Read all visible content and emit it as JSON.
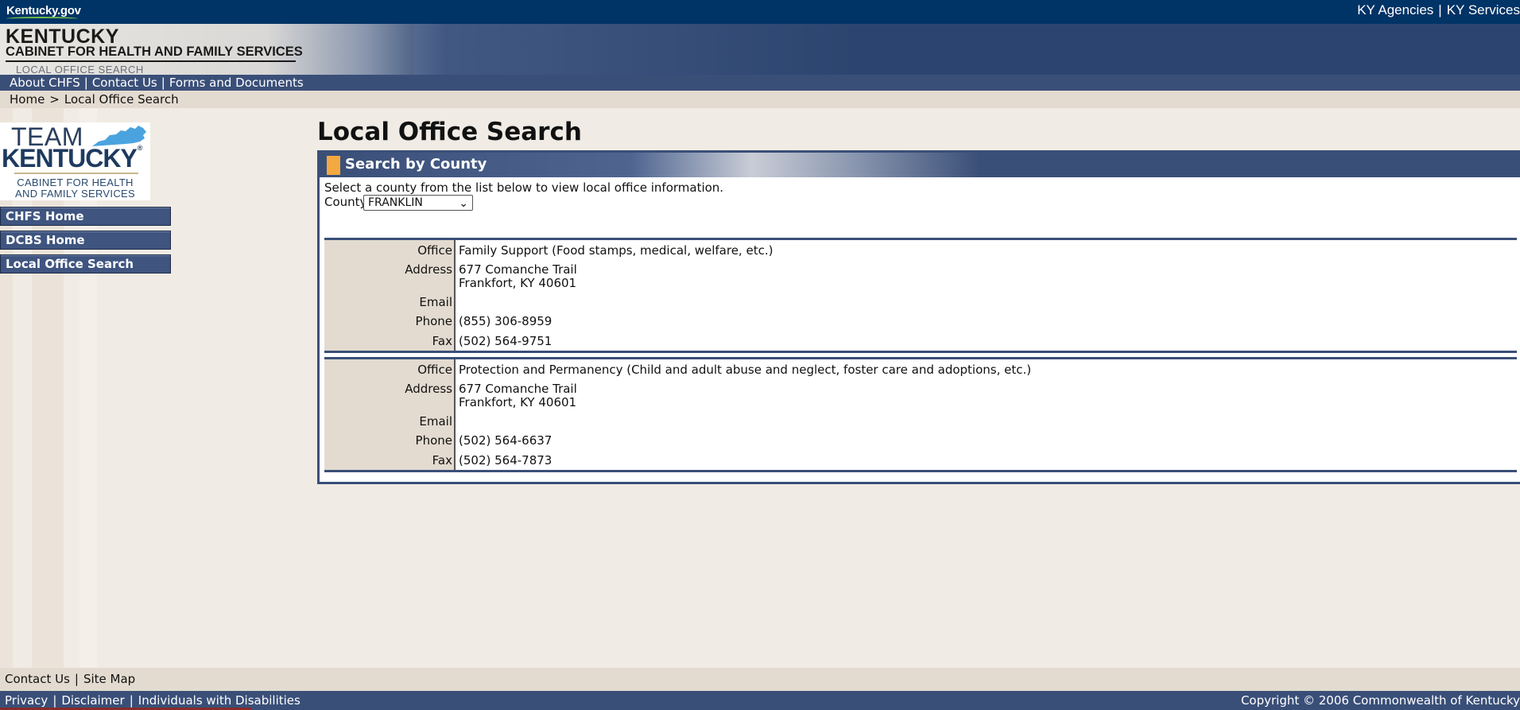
{
  "header": {
    "site_logo": "Kentucky.gov",
    "agencies_link": "KY Agencies",
    "services_link": "KY Services",
    "separator": "|",
    "banner_title": "KENTUCKY",
    "banner_subtitle": "CABINET FOR HEALTH AND FAMILY SERVICES",
    "banner_section": "LOCAL OFFICE SEARCH"
  },
  "nav": {
    "about": "About CHFS",
    "contact": "Contact Us",
    "forms": "Forms and Documents",
    "separator": "|"
  },
  "breadcrumb": {
    "home": "Home",
    "gt": ">",
    "current": "Local Office Search"
  },
  "sidebar": {
    "logo": {
      "team": "TEAM",
      "kentucky": "KENTUCKY",
      "reg": "®",
      "line1": "CABINET FOR HEALTH",
      "line2": "AND FAMILY SERVICES"
    },
    "items": [
      {
        "label": "CHFS Home"
      },
      {
        "label": "DCBS Home"
      },
      {
        "label": "Local Office Search"
      }
    ]
  },
  "main": {
    "title": "Local Office Search",
    "panel_title": "Search by County",
    "intro": "Select a county from the list below to view local office information.",
    "county_label": "County",
    "county_selected": "FRANKLIN",
    "labels": {
      "office": "Office",
      "address": "Address",
      "email": "Email",
      "phone": "Phone",
      "fax": "Fax"
    },
    "offices": [
      {
        "office": "Family Support (Food stamps, medical, welfare, etc.)",
        "address1": "677 Comanche Trail",
        "address2": "Frankfort, KY  40601",
        "email": "",
        "phone": "(855) 306-8959",
        "fax": "(502) 564-9751"
      },
      {
        "office": "Protection and Permanency (Child and adult abuse and neglect, foster care and adoptions, etc.)",
        "address1": "677 Comanche Trail",
        "address2": "Frankfort, KY  40601",
        "email": "",
        "phone": "(502) 564-6637",
        "fax": "(502) 564-7873"
      }
    ]
  },
  "footer": {
    "contact": "Contact Us",
    "sitemap": "Site Map",
    "privacy": "Privacy",
    "disclaimer": "Disclaimer",
    "disabilities": "Individuals with Disabilities",
    "copyright": "Copyright © 2006 Commonwealth of Kentucky",
    "separator": "|"
  },
  "colors": {
    "top_bar": "#003366",
    "nav_bar": "#3a4f78",
    "accent": "#f4a940",
    "page_bg": "#f0ebe4",
    "label_bg": "#e3dbd0"
  }
}
